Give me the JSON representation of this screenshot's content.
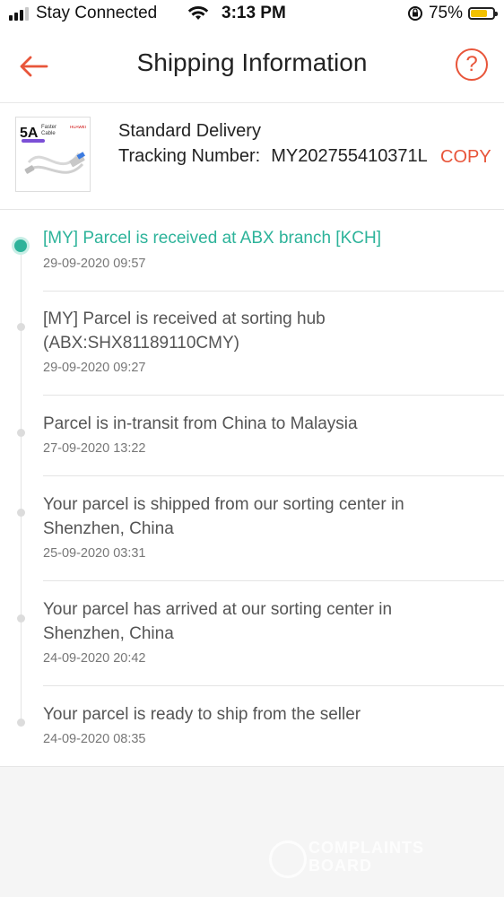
{
  "status_bar": {
    "carrier": "Stay Connected",
    "time": "3:13 PM",
    "battery_percent": "75%",
    "battery_level": 0.75,
    "icons": [
      "signal-icon",
      "wifi-icon",
      "orientation-lock-icon",
      "battery-icon"
    ]
  },
  "header": {
    "title": "Shipping Information",
    "back_icon": "back-arrow-icon",
    "help_label": "?"
  },
  "delivery": {
    "method": "Standard Delivery",
    "tracking_label": "Tracking Number:",
    "tracking_number": "MY202755410371L",
    "copy_label": "COPY",
    "thumbnail": {
      "badge": "5A",
      "text_line1": "Faster",
      "text_line2": "Cable",
      "brand": "HUAWEI"
    }
  },
  "timeline": [
    {
      "text": "[MY] Parcel is received at ABX branch [KCH]",
      "time": "29-09-2020 09:57",
      "active": true
    },
    {
      "text": "[MY] Parcel is received at sorting hub (ABX:SHX81189110CMY)",
      "time": "29-09-2020 09:27",
      "active": false
    },
    {
      "text": "Parcel is in-transit from China to Malaysia",
      "time": "27-09-2020 13:22",
      "active": false
    },
    {
      "text": "Your parcel is shipped from our sorting center in Shenzhen, China",
      "time": "25-09-2020 03:31",
      "active": false
    },
    {
      "text": "Your parcel has arrived at our sorting center in Shenzhen, China",
      "time": "24-09-2020 20:42",
      "active": false
    },
    {
      "text": "Your parcel is ready to ship from the seller",
      "time": "24-09-2020 08:35",
      "active": false
    }
  ],
  "watermark": {
    "line1": "COMPLAINTS",
    "line2": "BOARD"
  },
  "colors": {
    "accent": "#e8553a",
    "active_status": "#2db39a",
    "background": "#f5f5f5"
  }
}
